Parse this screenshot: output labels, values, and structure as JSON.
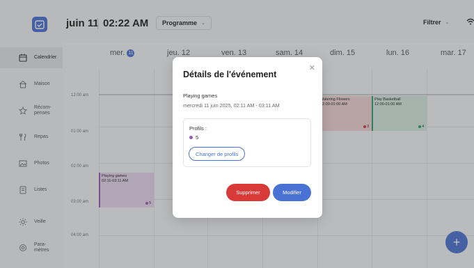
{
  "header": {
    "date": "juin 11",
    "time": "02:22 AM",
    "view_select": "Programme",
    "filter_select": "Filtrer"
  },
  "sidebar": {
    "items": [
      {
        "label": "Calendrier",
        "icon": "calendar-icon",
        "active": true
      },
      {
        "label": "Maison",
        "icon": "house-icon"
      },
      {
        "label": "Récom-\npenses",
        "icon": "star-icon"
      },
      {
        "label": "Repas",
        "icon": "fork-knife-icon"
      },
      {
        "label": "Photos",
        "icon": "image-icon"
      },
      {
        "label": "Listes",
        "icon": "list-icon"
      },
      {
        "label": "Veille",
        "icon": "sun-icon"
      },
      {
        "label": "Para-\nmètres",
        "icon": "gear-icon"
      }
    ]
  },
  "calendar": {
    "today_day_label": "mer.",
    "today_day_number": "11",
    "days": [
      "jeu. 12",
      "ven. 13",
      "sam. 14",
      "dim. 15",
      "lun. 16",
      "mar. 17"
    ],
    "hours": [
      "12:00 am",
      "01:00 am",
      "02:00 am",
      "03:00 am",
      "04:00 am"
    ],
    "events": [
      {
        "title": "Playing games",
        "time": "02:11-03:11 AM",
        "profile_count": "5",
        "color": "#9b59b6"
      },
      {
        "title": "Watering Flowers",
        "time": "12:00-01:00 AM",
        "profile_count": "3",
        "color": "#d83a3a"
      },
      {
        "title": "Play Basketball",
        "time": "12:00-01:00 AM",
        "profile_count": "4",
        "color": "#2e9e6e"
      }
    ]
  },
  "modal": {
    "title": "Détails de l'événement",
    "event_name": "Playing games",
    "event_date": "mercredi 11 juin 2025, 02:11 AM - 03:11 AM",
    "profiles_label": "Profils :",
    "profile_value": "5",
    "change_profiles_label": "Changer de profils",
    "delete_label": "Supprimer",
    "edit_label": "Modifier",
    "close_icon": "close-icon"
  },
  "colors": {
    "accent": "#4a72d4",
    "danger": "#d83a3a",
    "profile_purple": "#9b59b6"
  }
}
